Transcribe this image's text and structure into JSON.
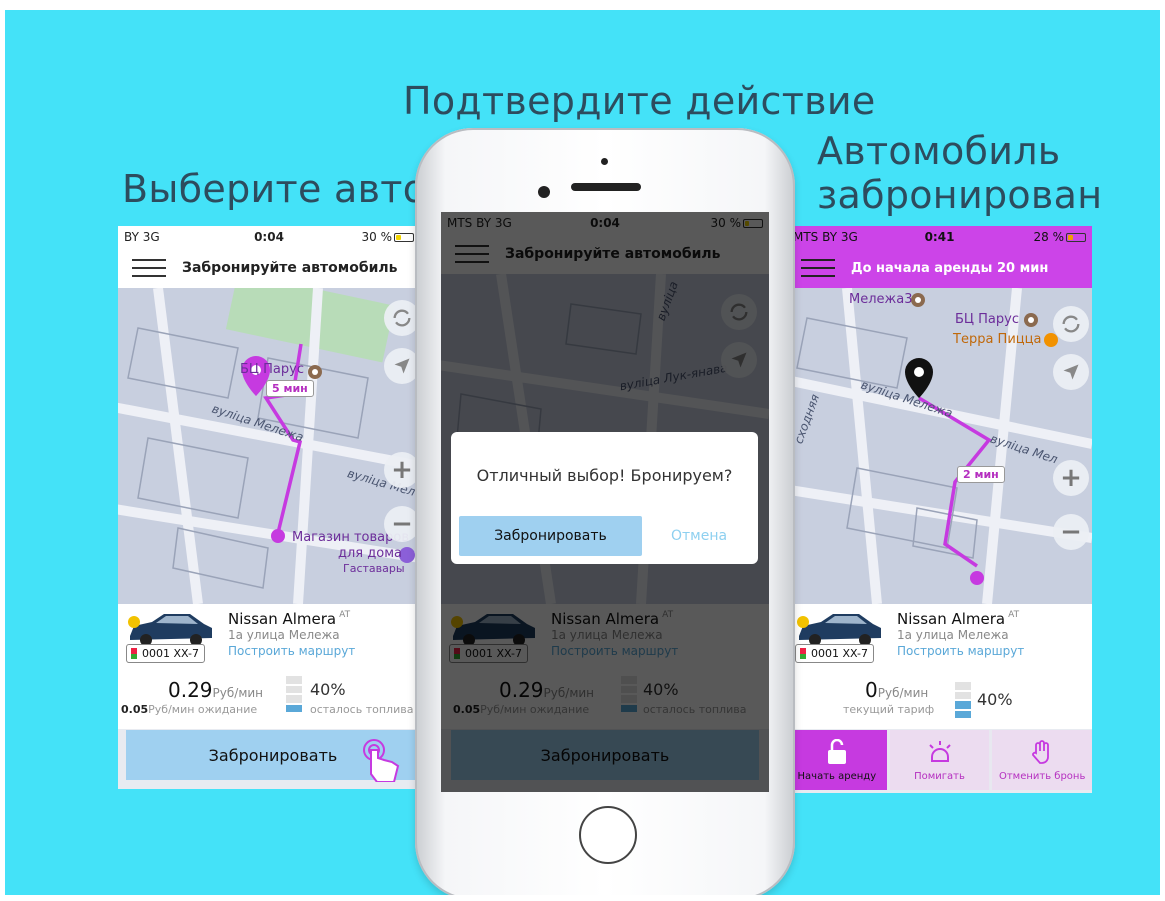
{
  "captions": {
    "left": "Выберите авто",
    "center": "Подтвердите действие",
    "right_line1": "Автомобиль",
    "right_line2": "забронирован"
  },
  "screen1": {
    "status": {
      "signal": "BY  3G",
      "time": "0:04",
      "battery": "30 %"
    },
    "title": "Забронируйте автомобиль",
    "map_labels": {
      "bc": "БЦ Парус",
      "store1": "Магазин товаров",
      "store2": "для дома",
      "store3": "Гаставары",
      "street1": "вуліца Мележа",
      "street2": "вуліца Мележ",
      "eta": "5 мин"
    },
    "car": {
      "name": "Nissan Almera",
      "trans": "AT",
      "address": "1а улица Мележа",
      "route": "Построить маршрут",
      "plate": "0001 XX-7",
      "plate_cc": "BY"
    },
    "price": {
      "value": "0.29",
      "unit": "Руб/мин",
      "wait_value": "0.05",
      "wait_label": "Руб/мин ожидание"
    },
    "fuel": {
      "percent": "40%",
      "label": "осталось топлива",
      "level": 0.4
    },
    "button": "Забронировать"
  },
  "screen2": {
    "status": {
      "signal": "MTS BY  3G",
      "time": "0:04",
      "battery": "30 %"
    },
    "title": "Забронируйте автомобиль",
    "map_labels": {
      "s1": "вуліца Лук-янава",
      "s2": "вуліца"
    },
    "dialog": {
      "question": "Отличный выбор! Бронируем?",
      "ok": "Забронировать",
      "cancel": "Отмена"
    },
    "car": {
      "name": "Nissan Almera",
      "trans": "AT",
      "address": "1а улица Мележа",
      "route": "Построить маршрут",
      "plate": "0001 XX-7"
    },
    "price": {
      "value": "0.29",
      "unit": "Руб/мин",
      "wait_value": "0.05",
      "wait_label": "Руб/мин ожидание"
    },
    "fuel": {
      "percent": "40%",
      "label": "осталось топлива"
    },
    "button": "Забронировать"
  },
  "screen3": {
    "status": {
      "signal": "MTS BY  3G",
      "time": "0:41",
      "battery": "28 %"
    },
    "title": "До начала аренды 20 мин",
    "map_labels": {
      "melezha": "Мележа3",
      "bc": "БЦ Парус",
      "pizza": "Терра Пицца",
      "street1": "вуліца Мележа",
      "street2": "вуліца Мел",
      "street3": "сходняя",
      "eta": "2 мин"
    },
    "car": {
      "name": "Nissan Almera",
      "trans": "AT",
      "address": "1а улица Мележа",
      "route": "Построить маршрут",
      "plate": "0001 XX-7"
    },
    "price": {
      "value": "0",
      "unit": "Руб/мин",
      "label": "текущий тариф"
    },
    "fuel": {
      "percent": "40%"
    },
    "actions": {
      "start": "Начать аренду",
      "blink": "Помигать",
      "cancel": "Отменить бронь"
    }
  },
  "colors": {
    "background": "#44e2f8",
    "accent": "#c63ae0",
    "button": "#9fd0f0",
    "caption": "#2d4c5e"
  }
}
